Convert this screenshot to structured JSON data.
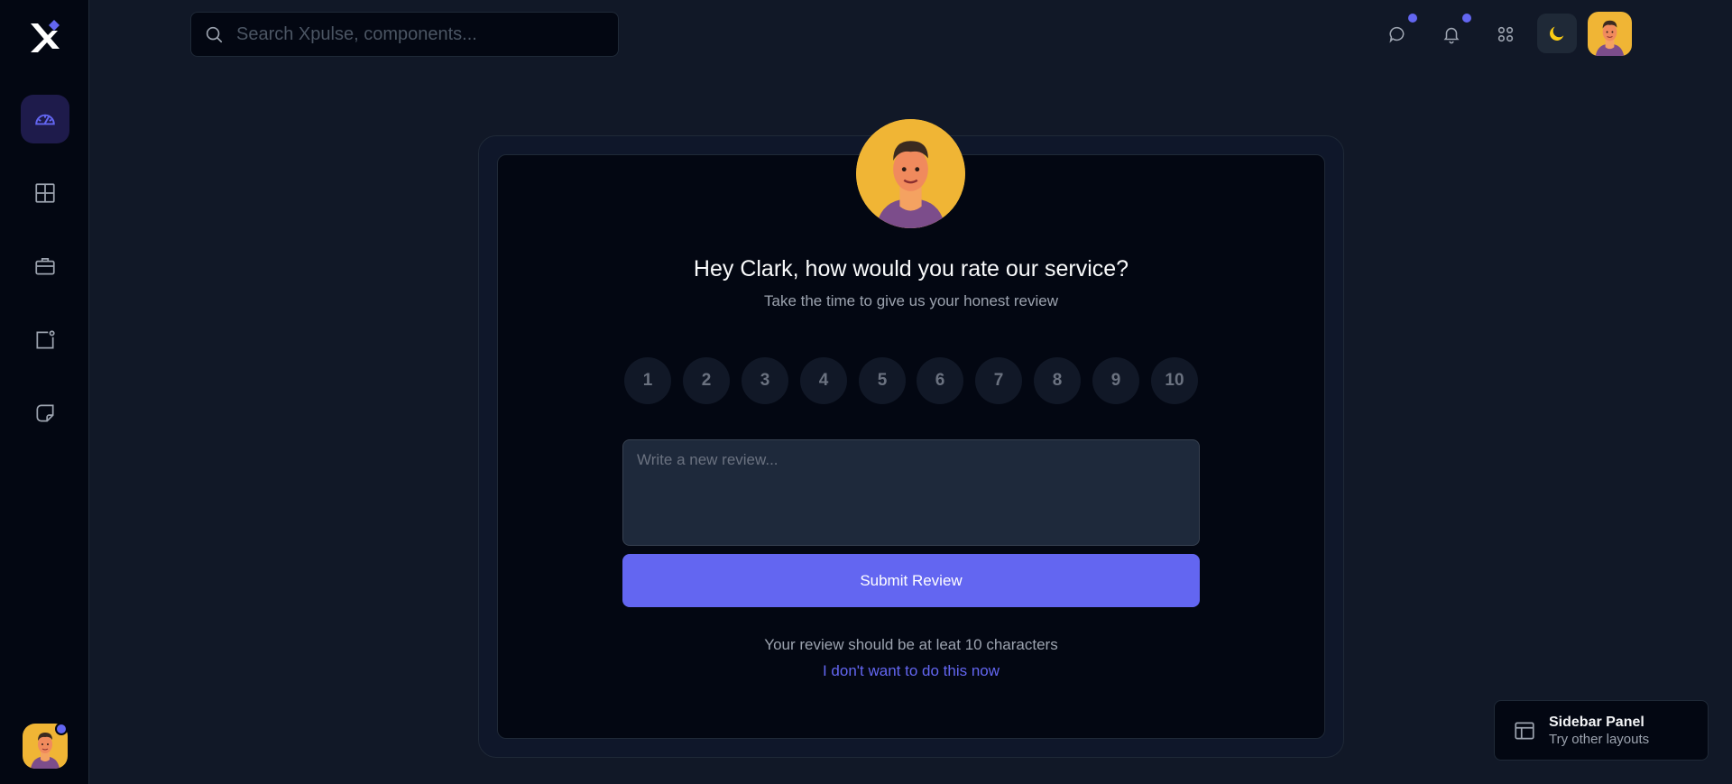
{
  "search": {
    "placeholder": "Search Xpulse, components..."
  },
  "sidebar": {
    "items": [
      {
        "name": "dashboard",
        "icon": "gauge-icon",
        "active": true
      },
      {
        "name": "layouts",
        "icon": "grid-icon",
        "active": false
      },
      {
        "name": "business",
        "icon": "briefcase-icon",
        "active": false
      },
      {
        "name": "layers",
        "icon": "square-dot-icon",
        "active": false
      },
      {
        "name": "notes",
        "icon": "sticky-note-icon",
        "active": false
      }
    ]
  },
  "header": {
    "icons": [
      "chat-icon",
      "bell-icon",
      "apps-icon",
      "moon-icon"
    ]
  },
  "review_card": {
    "title": "Hey Clark, how would you rate our service?",
    "subtitle": "Take the time to give us your honest review",
    "ratings": [
      "1",
      "2",
      "3",
      "4",
      "5",
      "6",
      "7",
      "8",
      "9",
      "10"
    ],
    "textarea_placeholder": "Write a new review...",
    "submit_label": "Submit Review",
    "hint": "Your review should be at leat 10 characters",
    "skip_label": "I don't want to do this now"
  },
  "panel": {
    "title": "Sidebar Panel",
    "subtitle": "Try other layouts"
  },
  "colors": {
    "accent": "#6366f1",
    "background": "#111827",
    "surface": "#030712",
    "avatar_bg": "#f0b535",
    "moon": "#facc15"
  }
}
